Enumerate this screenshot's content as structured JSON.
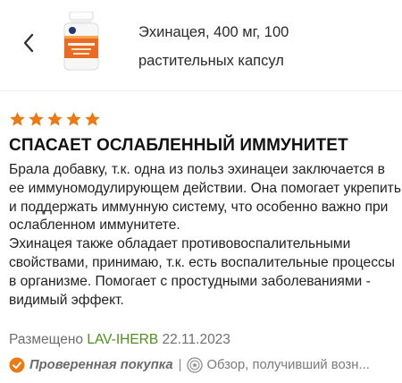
{
  "header": {
    "back_icon": "chevron-left-icon",
    "product_title_line1": "Эхинацея, 400 мг, 100",
    "product_title_line2": "растительных капсул",
    "product_image": {
      "brand": "NOW",
      "label": "Echinacea",
      "colors": {
        "bottle": "#f7f7f7",
        "cap": "#ffffff",
        "label": "#e86a24"
      }
    }
  },
  "review": {
    "rating": 5,
    "max_rating": 5,
    "star_color": "#ea7a14",
    "title": "СПАСАЕТ ОСЛАБЛЕННЫЙ ИММУНИТЕТ",
    "paragraph1": "Брала добавку, т.к. одна из польз эхинацеи заключается в ее иммуномодулирующем действии. Она помогает укрепить и поддержать иммунную систему, что особенно важно при ослабленном иммунитете.",
    "paragraph2": "Эхинацея также обладает противовоспалительными свойствами, принимаю, т.к. есть воспалительные процессы в организме. Помогает с простудными заболеваниями - видимый эффект.",
    "posted_label": "Размещено",
    "author": "LAV-IHERB",
    "date": "22.11.2023",
    "author_color": "#4e8f1d",
    "verified_label": "Проверенная покупка",
    "verified_icon": "verified-check-icon",
    "separator": "|",
    "reviewer_icon": "badge-icon",
    "reviewer_label": "Обзор, получивший возн..."
  }
}
